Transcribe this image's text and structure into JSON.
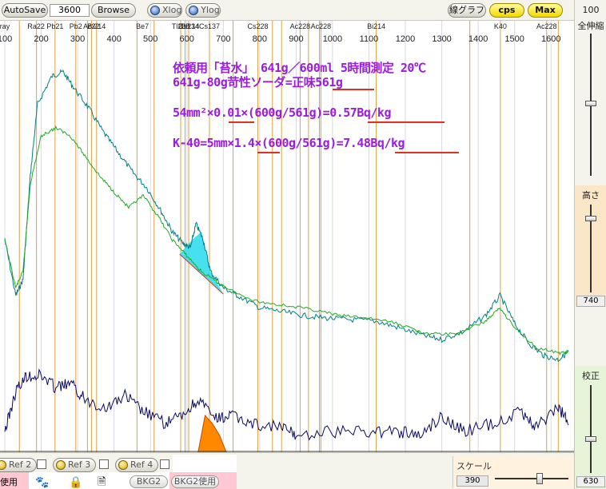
{
  "toolbar": {
    "autosave_label": "AutoSave",
    "count_value": "3600",
    "browse_label": "Browse",
    "xlog_label": "Xlog",
    "ylog_label": "Ylog",
    "linegraph_label": "線グラフ",
    "cps_label": "cps",
    "max_label": "Max"
  },
  "right_panel": {
    "top_value": "100",
    "zoom_all_label": "全伸縮",
    "height_label": "高さ",
    "height_value": "740",
    "calibrate_label": "校正",
    "calibrate_value": "630"
  },
  "annotations": {
    "line1": "依頼用「苔水」 641g／600ml 5時間測定 20℃",
    "line2": "641g-80g苛性ソーダ=正味561g",
    "line3": "54mm²×0.01×(600g/561g)=0.57Bq/kg",
    "line4": "K-40=5mm×1.4×(600g/561g)=7.48Bq/kg"
  },
  "bottom": {
    "ref2_label": "Ref 2",
    "ref3_label": "Ref 3",
    "ref4_label": "Ref 4",
    "use_label": "使用",
    "bkg2_label": "BKG2",
    "bkg2_use_label": "BKG2使用",
    "scale_label": "スケール",
    "scale_value": "390"
  },
  "chart_data": {
    "type": "line",
    "x_ticks": [
      100,
      200,
      300,
      400,
      500,
      600,
      700,
      800,
      900,
      1000,
      1100,
      1200,
      1300,
      1400,
      1500,
      1600
    ],
    "xlim": [
      100,
      1650
    ],
    "nuclide_labels": [
      {
        "label": "ray",
        "x": 100
      },
      {
        "label": "Ra22",
        "x": 186
      },
      {
        "label": "Pb21",
        "x": 238
      },
      {
        "label": "Pb2",
        "x": 295
      },
      {
        "label": "Ac22",
        "x": 338
      },
      {
        "label": "Bi214",
        "x": 352
      },
      {
        "label": "Be7",
        "x": 478
      },
      {
        "label": "Tl208",
        "x": 583
      },
      {
        "label": "Bi214",
        "x": 609
      },
      {
        "label": "Cs134",
        "x": 605
      },
      {
        "label": "Cs137",
        "x": 662
      },
      {
        "label": "Cs228",
        "x": 795
      },
      {
        "label": "Ac228",
        "x": 911
      },
      {
        "label": "Ac228",
        "x": 968
      },
      {
        "label": "Bi214",
        "x": 1120
      },
      {
        "label": "K40",
        "x": 1461
      },
      {
        "label": "Ac228",
        "x": 1588
      }
    ],
    "marker_lines": [
      140,
      187,
      238,
      295,
      327,
      338,
      352,
      463,
      510,
      583,
      595,
      605,
      662,
      727,
      795,
      835,
      860,
      911,
      934,
      964,
      968,
      1120,
      1377,
      1461,
      1588,
      1620
    ],
    "series": [
      {
        "color": "#008080",
        "values": [
          [
            100,
            300
          ],
          [
            130,
            370
          ],
          [
            150,
            350
          ],
          [
            170,
            220
          ],
          [
            190,
            130
          ],
          [
            230,
            95
          ],
          [
            260,
            90
          ],
          [
            290,
            110
          ],
          [
            330,
            135
          ],
          [
            370,
            165
          ],
          [
            410,
            190
          ],
          [
            450,
            215
          ],
          [
            490,
            235
          ],
          [
            530,
            265
          ],
          [
            560,
            290
          ],
          [
            590,
            305
          ],
          [
            610,
            310
          ],
          [
            625,
            280
          ],
          [
            645,
            300
          ],
          [
            665,
            340
          ],
          [
            700,
            360
          ],
          [
            740,
            370
          ],
          [
            800,
            385
          ],
          [
            860,
            390
          ],
          [
            920,
            395
          ],
          [
            980,
            398
          ],
          [
            1050,
            400
          ],
          [
            1120,
            402
          ],
          [
            1180,
            410
          ],
          [
            1250,
            420
          ],
          [
            1300,
            425
          ],
          [
            1360,
            415
          ],
          [
            1420,
            395
          ],
          [
            1460,
            370
          ],
          [
            1500,
            405
          ],
          [
            1540,
            430
          ],
          [
            1580,
            445
          ],
          [
            1620,
            450
          ],
          [
            1650,
            440
          ]
        ]
      },
      {
        "color": "#22aa22",
        "values": [
          [
            100,
            300
          ],
          [
            130,
            360
          ],
          [
            150,
            340
          ],
          [
            170,
            230
          ],
          [
            200,
            170
          ],
          [
            240,
            160
          ],
          [
            280,
            170
          ],
          [
            320,
            195
          ],
          [
            360,
            220
          ],
          [
            400,
            240
          ],
          [
            440,
            260
          ],
          [
            480,
            245
          ],
          [
            520,
            270
          ],
          [
            560,
            300
          ],
          [
            600,
            320
          ],
          [
            640,
            340
          ],
          [
            690,
            355
          ],
          [
            740,
            368
          ],
          [
            800,
            378
          ],
          [
            870,
            382
          ],
          [
            950,
            388
          ],
          [
            1020,
            395
          ],
          [
            1100,
            398
          ],
          [
            1180,
            405
          ],
          [
            1260,
            418
          ],
          [
            1340,
            418
          ],
          [
            1420,
            402
          ],
          [
            1460,
            385
          ],
          [
            1500,
            410
          ],
          [
            1560,
            435
          ],
          [
            1620,
            442
          ],
          [
            1650,
            440
          ]
        ]
      },
      {
        "color": "#0a0a60",
        "values": [
          [
            100,
            540
          ],
          [
            130,
            490
          ],
          [
            160,
            470
          ],
          [
            200,
            470
          ],
          [
            240,
            485
          ],
          [
            280,
            480
          ],
          [
            320,
            500
          ],
          [
            380,
            510
          ],
          [
            430,
            495
          ],
          [
            480,
            515
          ],
          [
            540,
            530
          ],
          [
            590,
            520
          ],
          [
            630,
            500
          ],
          [
            680,
            525
          ],
          [
            720,
            520
          ],
          [
            780,
            530
          ],
          [
            860,
            535
          ],
          [
            900,
            545
          ],
          [
            1000,
            540
          ],
          [
            1100,
            540
          ],
          [
            1180,
            540
          ],
          [
            1240,
            545
          ],
          [
            1300,
            520
          ],
          [
            1360,
            540
          ],
          [
            1440,
            530
          ],
          [
            1520,
            515
          ],
          [
            1560,
            535
          ],
          [
            1620,
            510
          ],
          [
            1650,
            530
          ]
        ]
      }
    ],
    "peak_fills": [
      {
        "color": "#33ddee",
        "x_range": [
          580,
          700
        ]
      },
      {
        "color": "#ff8800",
        "x_range": [
          630,
          710
        ]
      }
    ]
  }
}
